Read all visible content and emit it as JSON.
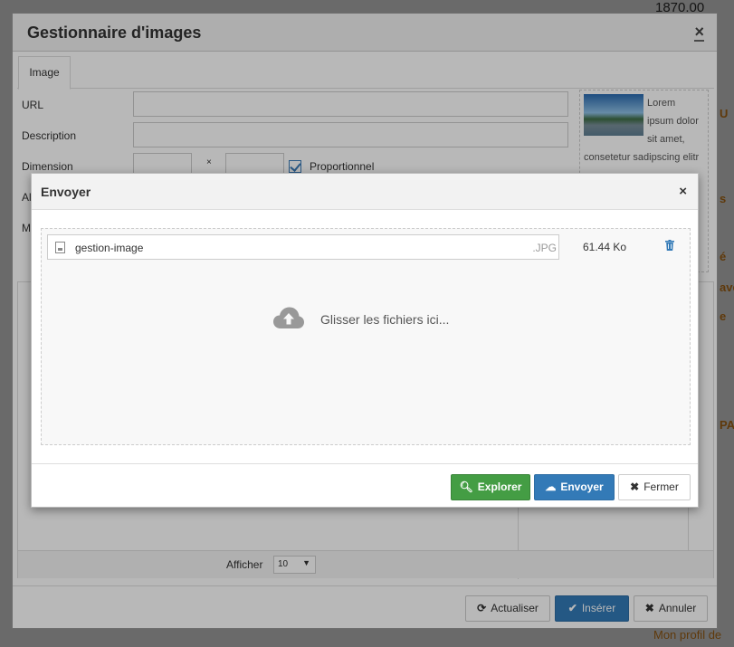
{
  "background": {
    "amount": "1870.00",
    "footer_link": "Mon profil de",
    "side_fragments": [
      "U",
      "s",
      "é",
      "ave",
      "e",
      "PA"
    ]
  },
  "image_manager": {
    "title": "Gestionnaire d'images",
    "close": "×",
    "tabs": [
      {
        "label": "Image"
      }
    ],
    "fields": {
      "url_label": "URL",
      "description_label": "Description",
      "dimension_label": "Dimension",
      "dimension_separator": "×",
      "proportional_label": "Proportionnel",
      "hidden_label_1": "Al",
      "hidden_label_2": "M"
    },
    "preview_text": "Lorem ipsum dolor sit amet, consetetur sadipscing elitr",
    "show_label": "Afficher",
    "show_value": "10",
    "buttons": {
      "refresh": "Actualiser",
      "insert": "Insérer",
      "cancel": "Annuler"
    }
  },
  "upload_dialog": {
    "title": "Envoyer",
    "close": "×",
    "files": [
      {
        "name": "gestion-image",
        "extension": ".JPG",
        "size": "61.44 Ko"
      }
    ],
    "drop_message": "Glisser les fichiers ici...",
    "buttons": {
      "browse": "Explorer",
      "upload": "Envoyer",
      "close": "Fermer"
    }
  },
  "colors": {
    "primary": "#337ab7",
    "success": "#449d44",
    "accent": "#e38a1c"
  }
}
